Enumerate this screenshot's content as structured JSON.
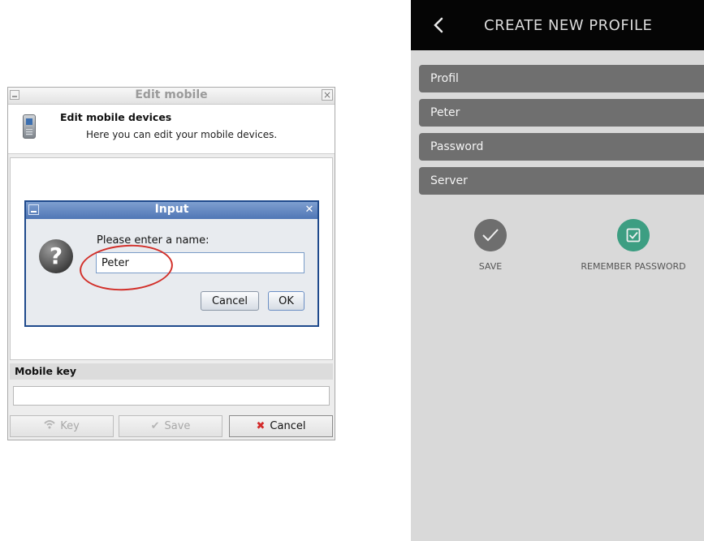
{
  "edit_window": {
    "title": "Edit mobile",
    "header_title": "Edit mobile devices",
    "header_subtitle": "Here you can edit your mobile devices.",
    "mobile_key_label": "Mobile key",
    "buttons": {
      "key": "Key",
      "save": "Save",
      "cancel": "Cancel"
    }
  },
  "input_dialog": {
    "title": "Input",
    "prompt": "Please enter a name:",
    "value": "Peter",
    "cancel": "Cancel",
    "ok": "OK"
  },
  "mobile": {
    "title": "CREATE NEW PROFILE",
    "fields": [
      "Profil",
      "Peter",
      "Password",
      "Server"
    ],
    "save_label": "SAVE",
    "remember_label": "REMEMBER PASSWORD"
  },
  "colors": {
    "dialog_title_blue": "#4f76b5",
    "highlight_circle": "#d2302a",
    "mobile_topbar": "#050505",
    "field_bg": "#6f6f6f",
    "remember_green": "#3d9e82"
  }
}
